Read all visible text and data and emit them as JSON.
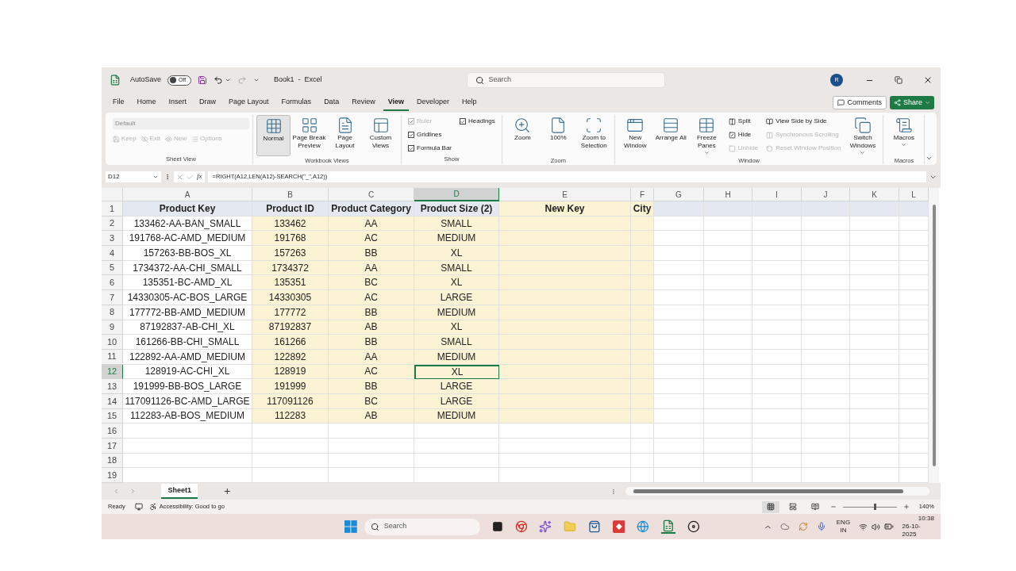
{
  "window": {
    "title": "Book1  -  Excel",
    "autosave_label": "AutoSave",
    "autosave": {
      "on": false,
      "label": "Off"
    },
    "search_placeholder": "Search",
    "avatar": "R"
  },
  "ribbon_tabs": [
    {
      "label": "File",
      "selected": false
    },
    {
      "label": "Home",
      "selected": false
    },
    {
      "label": "Insert",
      "selected": false
    },
    {
      "label": "Draw",
      "selected": false
    },
    {
      "label": "Page Layout",
      "selected": false
    },
    {
      "label": "Formulas",
      "selected": false
    },
    {
      "label": "Data",
      "selected": false
    },
    {
      "label": "Review",
      "selected": false
    },
    {
      "label": "View",
      "selected": true
    },
    {
      "label": "Developer",
      "selected": false
    },
    {
      "label": "Help",
      "selected": false
    }
  ],
  "comments_button": "Comments",
  "share_button": "Share",
  "ribbon_groups": [
    {
      "title": "Sheet View",
      "columns": [
        {
          "kind": "sheetview",
          "combo": "Default",
          "items": [
            {
              "label": "Keep",
              "disabled": true
            },
            {
              "label": "Exit",
              "disabled": true
            },
            {
              "label": "New",
              "disabled": true
            },
            {
              "label": "Options",
              "disabled": true
            }
          ]
        }
      ]
    },
    {
      "title": "Workbook Views",
      "columns": [
        {
          "kind": "large",
          "label": "Normal",
          "selected": true
        },
        {
          "kind": "large",
          "label": "Page Break Preview",
          "selected": false
        },
        {
          "kind": "large",
          "label": "Page Layout",
          "selected": false
        },
        {
          "kind": "large",
          "label": "Custom Views",
          "selected": false
        }
      ]
    },
    {
      "title": "Show",
      "columns": [
        {
          "kind": "stack",
          "items": [
            {
              "kind": "check",
              "label": "Ruler",
              "checked": true,
              "disabled": true
            },
            {
              "kind": "check",
              "label": "Gridlines",
              "checked": true,
              "disabled": false
            },
            {
              "kind": "check",
              "label": "Formula Bar",
              "checked": true,
              "disabled": false
            }
          ]
        },
        {
          "kind": "stack",
          "items": [
            {
              "kind": "check",
              "label": "Headings",
              "checked": true,
              "disabled": false
            }
          ]
        }
      ]
    },
    {
      "title": "Zoom",
      "columns": [
        {
          "kind": "large",
          "label": "Zoom",
          "selected": false
        },
        {
          "kind": "large",
          "label": "100%",
          "selected": false
        },
        {
          "kind": "large",
          "label": "Zoom to Selection",
          "selected": false
        }
      ]
    },
    {
      "title": "Window",
      "columns": [
        {
          "kind": "large",
          "label": "New Window",
          "selected": false
        },
        {
          "kind": "large",
          "label": "Arrange All",
          "selected": false
        },
        {
          "kind": "large",
          "label": "Freeze Panes",
          "selected": false,
          "dropdown": true
        },
        {
          "kind": "stack",
          "items": [
            {
              "kind": "small",
              "label": "Split",
              "disabled": false
            },
            {
              "kind": "small",
              "label": "Hide",
              "disabled": false
            },
            {
              "kind": "small",
              "label": "Unhide",
              "disabled": true
            }
          ]
        },
        {
          "kind": "stack",
          "items": [
            {
              "kind": "small",
              "label": "View Side by Side",
              "disabled": false
            },
            {
              "kind": "small",
              "label": "Synchronous Scrolling",
              "disabled": true
            },
            {
              "kind": "small",
              "label": "Reset Window Position",
              "disabled": true
            }
          ]
        },
        {
          "kind": "large",
          "label": "Switch Windows",
          "selected": false,
          "dropdown": true
        }
      ]
    },
    {
      "title": "Macros",
      "columns": [
        {
          "kind": "large",
          "label": "Macros",
          "selected": false,
          "dropdown": true
        }
      ]
    }
  ],
  "formula_bar": {
    "name_box": "D12",
    "fx": "fx",
    "formula": "=RIGHT(A12,LEN(A12)-SEARCH(\"_\",A12))"
  },
  "columns": [
    {
      "letter": "A",
      "selected": false,
      "filled": false
    },
    {
      "letter": "B",
      "selected": false,
      "filled": true
    },
    {
      "letter": "C",
      "selected": false,
      "filled": true
    },
    {
      "letter": "D",
      "selected": true,
      "filled": true
    },
    {
      "letter": "E",
      "selected": false,
      "filled": true
    },
    {
      "letter": "F",
      "selected": false,
      "filled": true
    },
    {
      "letter": "G",
      "selected": false,
      "filled": false
    },
    {
      "letter": "H",
      "selected": false,
      "filled": false
    },
    {
      "letter": "I",
      "selected": false,
      "filled": false
    },
    {
      "letter": "J",
      "selected": false,
      "filled": false
    },
    {
      "letter": "K",
      "selected": false,
      "filled": false
    },
    {
      "letter": "L",
      "selected": false,
      "filled": false
    }
  ],
  "rows": [
    {
      "number": "1",
      "selected": false,
      "kind": "header",
      "cells": [
        "Product Key",
        "Product ID",
        "Product Category",
        "Product Size (2)",
        "New Key",
        "City"
      ]
    },
    {
      "number": "2",
      "selected": false,
      "kind": "data",
      "cells": [
        "133462-AA-BAN_SMALL",
        "133462",
        "AA",
        "SMALL"
      ]
    },
    {
      "number": "3",
      "selected": false,
      "kind": "data",
      "cells": [
        "191768-AC-AMD_MEDIUM",
        "191768",
        "AC",
        "MEDIUM"
      ]
    },
    {
      "number": "4",
      "selected": false,
      "kind": "data",
      "cells": [
        "157263-BB-BOS_XL",
        "157263",
        "BB",
        "XL"
      ]
    },
    {
      "number": "5",
      "selected": false,
      "kind": "data",
      "cells": [
        "1734372-AA-CHI_SMALL",
        "1734372",
        "AA",
        "SMALL"
      ]
    },
    {
      "number": "6",
      "selected": false,
      "kind": "data",
      "cells": [
        "135351-BC-AMD_XL",
        "135351",
        "BC",
        "XL"
      ]
    },
    {
      "number": "7",
      "selected": false,
      "kind": "data",
      "cells": [
        "14330305-AC-BOS_LARGE",
        "14330305",
        "AC",
        "LARGE"
      ]
    },
    {
      "number": "8",
      "selected": false,
      "kind": "data",
      "cells": [
        "177772-BB-AMD_MEDIUM",
        "177772",
        "BB",
        "MEDIUM"
      ]
    },
    {
      "number": "9",
      "selected": false,
      "kind": "data",
      "cells": [
        "87192837-AB-CHI_XL",
        "87192837",
        "AB",
        "XL"
      ]
    },
    {
      "number": "10",
      "selected": false,
      "kind": "data",
      "cells": [
        "161266-BB-CHI_SMALL",
        "161266",
        "BB",
        "SMALL"
      ]
    },
    {
      "number": "11",
      "selected": false,
      "kind": "data",
      "cells": [
        "122892-AA-AMD_MEDIUM",
        "122892",
        "AA",
        "MEDIUM"
      ]
    },
    {
      "number": "12",
      "selected": true,
      "kind": "data",
      "cells": [
        "128919-AC-CHI_XL",
        "128919",
        "AC",
        "XL"
      ]
    },
    {
      "number": "13",
      "selected": false,
      "kind": "data",
      "cells": [
        "191999-BB-BOS_LARGE",
        "191999",
        "BB",
        "LARGE"
      ]
    },
    {
      "number": "14",
      "selected": false,
      "kind": "data",
      "cells": [
        "117091126-BC-AMD_LARGE",
        "117091126",
        "BC",
        "LARGE"
      ]
    },
    {
      "number": "15",
      "selected": false,
      "kind": "data",
      "cells": [
        "112283-AB-BOS_MEDIUM",
        "112283",
        "AB",
        "MEDIUM"
      ]
    },
    {
      "number": "16",
      "selected": false,
      "kind": "empty"
    },
    {
      "number": "17",
      "selected": false,
      "kind": "empty"
    },
    {
      "number": "18",
      "selected": false,
      "kind": "empty"
    },
    {
      "number": "19",
      "selected": false,
      "kind": "empty"
    }
  ],
  "sheet_tabs": [
    {
      "label": "Sheet1",
      "selected": true
    }
  ],
  "status_bar": {
    "mode": "Ready",
    "accessibility": "Accessibility: Good to go",
    "view_buttons": [
      {
        "selected": true
      },
      {
        "selected": false
      },
      {
        "selected": false
      }
    ],
    "zoom": {
      "level": 0.57,
      "label": "140%"
    }
  },
  "taskbar": {
    "search_placeholder": "Search",
    "language": "ENG",
    "region": "IN",
    "time": "10:38",
    "date": "26-10-2025"
  }
}
